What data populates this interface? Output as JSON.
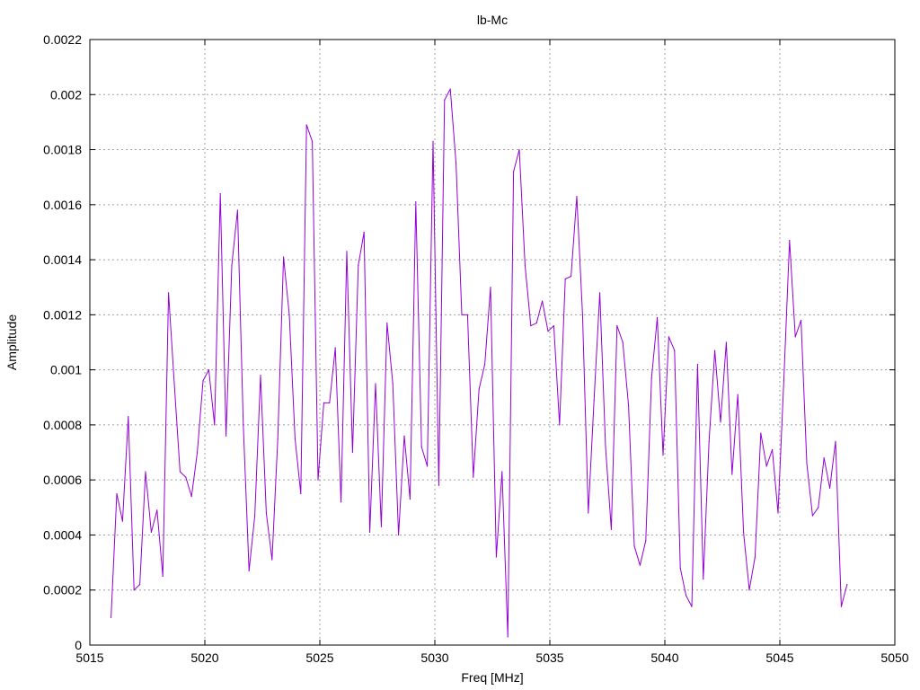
{
  "chart_data": {
    "type": "line",
    "title": "lb-Mc",
    "xlabel": "Freq [MHz]",
    "ylabel": "Amplitude",
    "xlim": [
      5015,
      5050
    ],
    "ylim": [
      0,
      0.0022
    ],
    "xticks": [
      "5015",
      "5020",
      "5025",
      "5030",
      "5035",
      "5040",
      "5045",
      "5050"
    ],
    "yticks": [
      "0",
      "0.0002",
      "0.0004",
      "0.0006",
      "0.0008",
      "0.001",
      "0.0012",
      "0.0014",
      "0.0016",
      "0.0018",
      "0.002",
      "0.0022"
    ],
    "grid": true,
    "line_color": "#9400d3",
    "series": [
      {
        "x": [
          5015.92,
          5016.17,
          5016.42,
          5016.67,
          5016.92,
          5017.17,
          5017.42,
          5017.67,
          5017.92,
          5018.17,
          5018.42,
          5018.67,
          5018.92,
          5019.17,
          5019.42,
          5019.67,
          5019.92,
          5020.17,
          5020.42,
          5020.67,
          5020.92,
          5021.17,
          5021.42,
          5021.67,
          5021.92,
          5022.17,
          5022.42,
          5022.67,
          5022.92,
          5023.17,
          5023.42,
          5023.67,
          5023.92,
          5024.17,
          5024.42,
          5024.67,
          5024.92,
          5025.17,
          5025.42,
          5025.67,
          5025.92,
          5026.17,
          5026.42,
          5026.67,
          5026.92,
          5027.17,
          5027.42,
          5027.67,
          5027.92,
          5028.17,
          5028.42,
          5028.67,
          5028.92,
          5029.17,
          5029.42,
          5029.67,
          5029.92,
          5030.17,
          5030.42,
          5030.67,
          5030.92,
          5031.17,
          5031.42,
          5031.67,
          5031.92,
          5032.17,
          5032.42,
          5032.67,
          5032.92,
          5033.17,
          5033.42,
          5033.67,
          5033.92,
          5034.17,
          5034.42,
          5034.67,
          5034.92,
          5035.17,
          5035.42,
          5035.67,
          5035.92,
          5036.17,
          5036.42,
          5036.67,
          5036.92,
          5037.17,
          5037.42,
          5037.67,
          5037.92,
          5038.17,
          5038.42,
          5038.67,
          5038.92,
          5039.17,
          5039.42,
          5039.67,
          5039.92,
          5040.17,
          5040.42,
          5040.67,
          5040.92,
          5041.17,
          5041.42,
          5041.67,
          5041.92,
          5042.17,
          5042.42,
          5042.67,
          5042.92,
          5043.17,
          5043.42,
          5043.67,
          5043.92,
          5044.17,
          5044.42,
          5044.67,
          5044.92,
          5045.17,
          5045.42,
          5045.67,
          5045.92,
          5046.17,
          5046.42,
          5046.67,
          5046.92,
          5047.17,
          5047.42,
          5047.67,
          5047.92
        ],
        "y": [
          0.0001,
          0.00055,
          0.00045,
          0.00083,
          0.0002,
          0.00022,
          0.00063,
          0.00041,
          0.00049,
          0.00025,
          0.00128,
          0.00095,
          0.00063,
          0.00061,
          0.00054,
          0.0007,
          0.00096,
          0.001,
          0.0008,
          0.00164,
          0.00076,
          0.00138,
          0.00158,
          0.0008,
          0.00027,
          0.00047,
          0.00098,
          0.00048,
          0.00031,
          0.00075,
          0.00141,
          0.0012,
          0.00075,
          0.00055,
          0.00189,
          0.00183,
          0.0006,
          0.00088,
          0.00088,
          0.00108,
          0.00052,
          0.00143,
          0.0007,
          0.00138,
          0.0015,
          0.00041,
          0.00095,
          0.00043,
          0.00117,
          0.00095,
          0.0004,
          0.00076,
          0.00053,
          0.00161,
          0.00072,
          0.00065,
          0.00183,
          0.00058,
          0.00198,
          0.00202,
          0.00175,
          0.0012,
          0.0012,
          0.00061,
          0.00093,
          0.00102,
          0.0013,
          0.00032,
          0.00063,
          3e-05,
          0.00172,
          0.0018,
          0.00138,
          0.00116,
          0.00117,
          0.00125,
          0.00114,
          0.00116,
          0.0008,
          0.00133,
          0.00134,
          0.00163,
          0.0012,
          0.00048,
          0.00089,
          0.00128,
          0.00072,
          0.00042,
          0.00116,
          0.0011,
          0.00087,
          0.00036,
          0.00029,
          0.00038,
          0.00097,
          0.00119,
          0.00069,
          0.00112,
          0.00107,
          0.00028,
          0.00018,
          0.00014,
          0.00102,
          0.00024,
          0.00074,
          0.00107,
          0.00081,
          0.0011,
          0.00062,
          0.00091,
          0.00041,
          0.0002,
          0.00032,
          0.00077,
          0.00065,
          0.00071,
          0.00048,
          0.00096,
          0.00147,
          0.00112,
          0.00118,
          0.00066,
          0.00047,
          0.0005,
          0.00068,
          0.00057,
          0.00074,
          0.00014,
          0.00022
        ]
      }
    ]
  }
}
